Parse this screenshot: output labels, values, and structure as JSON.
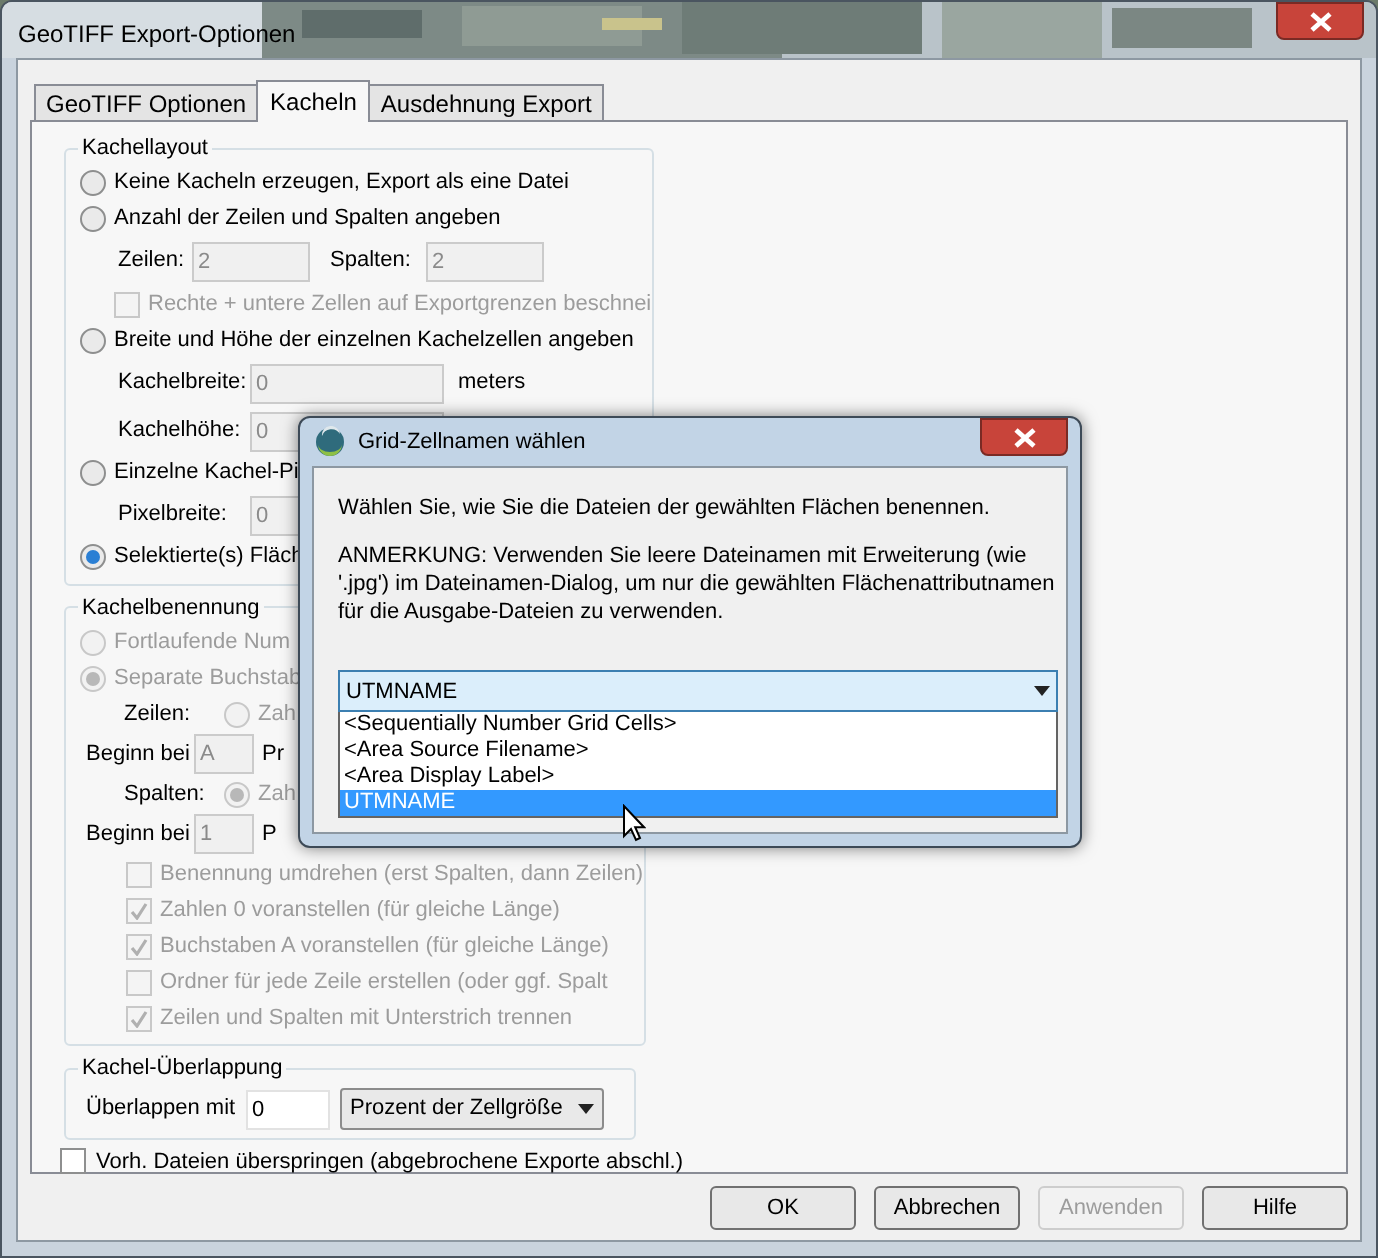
{
  "window": {
    "title": "GeoTIFF Export-Optionen"
  },
  "tabs": [
    {
      "label": "GeoTIFF Optionen",
      "selected": false
    },
    {
      "label": "Kacheln",
      "selected": true
    },
    {
      "label": "Ausdehnung Export",
      "selected": false
    }
  ],
  "tiling_layout": {
    "title": "Kachellayout",
    "rows": [
      {
        "kind": "radio",
        "label": "Keine Kacheln erzeugen, Export als eine Datei",
        "selected": false,
        "disabled": false
      },
      {
        "kind": "radio",
        "label": "Anzahl der Zeilen und Spalten angeben",
        "selected": false,
        "disabled": false
      },
      {
        "kind": "fields",
        "disabled": true,
        "items": [
          {
            "label": "Zeilen:",
            "value": "2"
          },
          {
            "label": "Spalten:",
            "value": "2"
          }
        ]
      },
      {
        "kind": "checkbox",
        "label": "Rechte + untere Zellen auf Exportgrenzen beschnei",
        "checked": false,
        "disabled": true
      },
      {
        "kind": "radio",
        "label": "Breite und Höhe der einzelnen Kachelzellen angeben",
        "selected": false,
        "disabled": false
      },
      {
        "kind": "fields",
        "disabled": true,
        "items": [
          {
            "label": "Kachelbreite:",
            "value": "0",
            "unit": "meters"
          }
        ]
      },
      {
        "kind": "fields",
        "disabled": true,
        "items": [
          {
            "label": "Kachelhöhe:",
            "value": "0"
          }
        ]
      },
      {
        "kind": "radio",
        "label": "Einzelne Kachel-Pi",
        "selected": false,
        "disabled": false
      },
      {
        "kind": "fields",
        "disabled": true,
        "items": [
          {
            "label": "Pixelbreite:",
            "value": "0"
          }
        ]
      },
      {
        "kind": "radio",
        "label": "Selektierte(s) Fläch",
        "selected": true,
        "disabled": false
      }
    ]
  },
  "tile_naming": {
    "title": "Kachelbenennung",
    "rows": [
      {
        "kind": "radio",
        "label": "Fortlaufende Num",
        "selected": false,
        "disabled": true
      },
      {
        "kind": "radio",
        "label": "Separate Buchstab",
        "selected": true,
        "disabled": true
      },
      {
        "kind": "inline_radio",
        "label": "Zeilen:",
        "option": "Zah",
        "selected": false,
        "disabled": true
      },
      {
        "kind": "start_field",
        "label": "Beginn bei",
        "value": "A",
        "suffix": "Pr",
        "disabled": true
      },
      {
        "kind": "inline_radio",
        "label": "Spalten:",
        "option": "Zah",
        "selected": true,
        "disabled": true
      },
      {
        "kind": "start_field",
        "label": "Beginn bei",
        "value": "1",
        "suffix": "P",
        "disabled": true
      },
      {
        "kind": "checkbox",
        "label": "Benennung umdrehen (erst Spalten, dann Zeilen)",
        "checked": false,
        "disabled": true
      },
      {
        "kind": "checkbox",
        "label": "Zahlen 0 voranstellen (für gleiche Länge)",
        "checked": true,
        "disabled": true
      },
      {
        "kind": "checkbox",
        "label": "Buchstaben A voranstellen (für gleiche Länge)",
        "checked": true,
        "disabled": true
      },
      {
        "kind": "checkbox",
        "label": "Ordner für jede Zeile erstellen (oder ggf. Spalt",
        "checked": false,
        "disabled": true
      },
      {
        "kind": "checkbox",
        "label": "Zeilen und Spalten mit Unterstrich trennen",
        "checked": true,
        "disabled": true
      }
    ]
  },
  "overlap": {
    "title": "Kachel-Überlappung",
    "label": "Überlappen mit",
    "value": "0",
    "unit": "Prozent der Zellgröße"
  },
  "skip_existing": {
    "label": "Vorh. Dateien überspringen (abgebrochene Exporte abschl.)",
    "checked": false
  },
  "buttons": [
    {
      "label": "OK",
      "disabled": false
    },
    {
      "label": "Abbrechen",
      "disabled": false
    },
    {
      "label": "Anwenden",
      "disabled": true
    },
    {
      "label": "Hilfe",
      "disabled": false
    }
  ],
  "dialog": {
    "title": "Grid-Zellnamen wählen",
    "message": "Wählen Sie, wie Sie die Dateien der gewählten Flächen benennen.",
    "note": "ANMERKUNG: Verwenden Sie leere Dateinamen mit Erweiterung (wie '.jpg') im Dateinamen-Dialog, um nur die gewählten Flächenattributnamen für die Ausgabe-Dateien zu verwenden.",
    "combo_value": "UTMNAME",
    "options": [
      {
        "label": "<Sequentially Number Grid Cells>",
        "selected": false
      },
      {
        "label": "<Area Source Filename>",
        "selected": false
      },
      {
        "label": "<Area Display Label>",
        "selected": false
      },
      {
        "label": "UTMNAME",
        "selected": true
      }
    ]
  }
}
